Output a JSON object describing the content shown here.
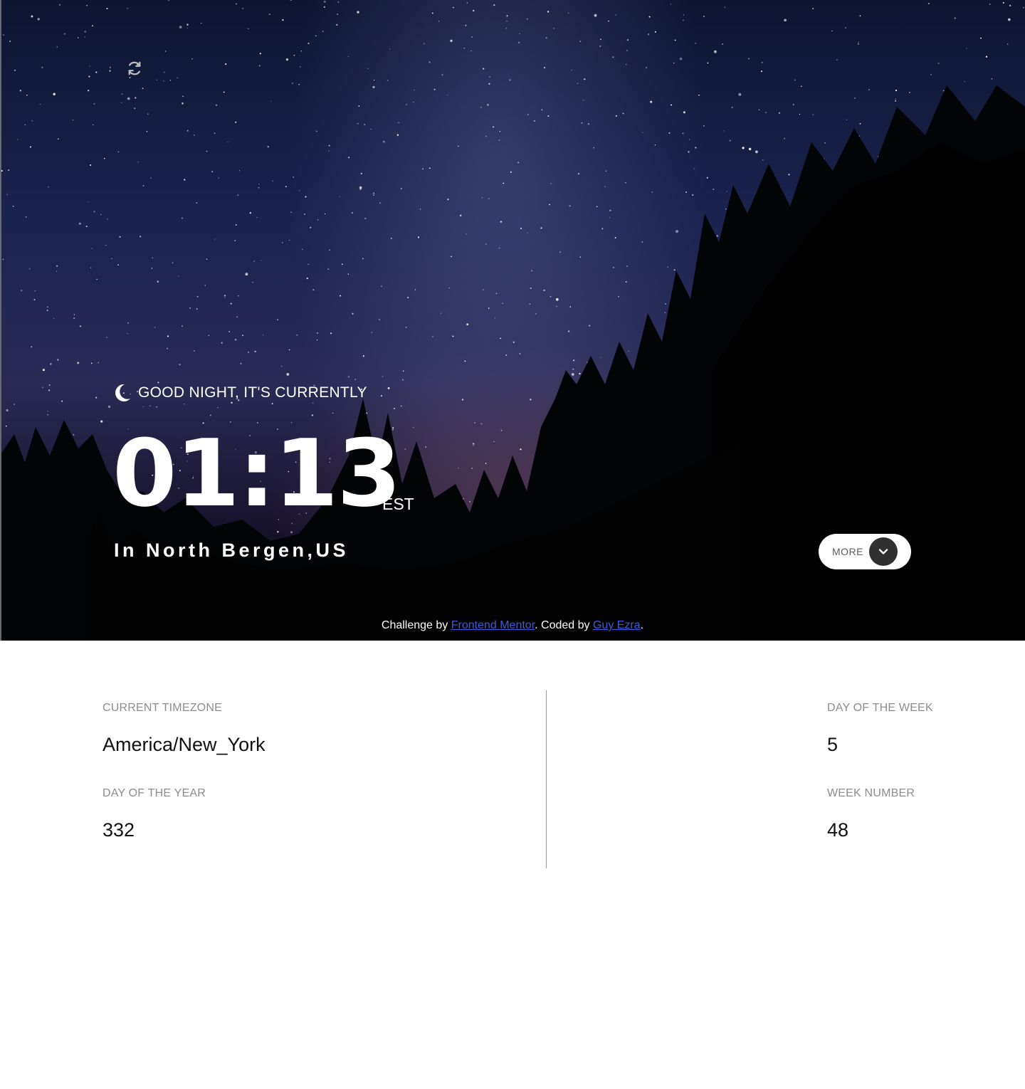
{
  "header": {
    "refresh_icon": "refresh-icon"
  },
  "greeting": {
    "icon": "moon-icon",
    "text": "GOOD NIGHT, IT'S CURRENTLY"
  },
  "clock": {
    "time": "01:13",
    "timezone_abbr": "EST",
    "location": "In North Bergen,US"
  },
  "more_button": {
    "label": "MORE",
    "icon": "chevron-down-icon"
  },
  "attribution": {
    "prefix": "Challenge by ",
    "link1": "Frontend Mentor",
    "middle": ". Coded by ",
    "link2": "Guy Ezra",
    "suffix": "."
  },
  "details": {
    "timezone_label": "CURRENT TIMEZONE",
    "timezone_value": "America/New_York",
    "day_of_year_label": "DAY OF THE YEAR",
    "day_of_year_value": "332",
    "day_of_week_label": "DAY OF THE WEEK",
    "day_of_week_value": "5",
    "week_number_label": "WEEK NUMBER",
    "week_number_value": "48"
  },
  "colors": {
    "link": "#3b5bd8",
    "button_chevron_bg": "#303030",
    "label_gray": "#8c8c8c"
  }
}
